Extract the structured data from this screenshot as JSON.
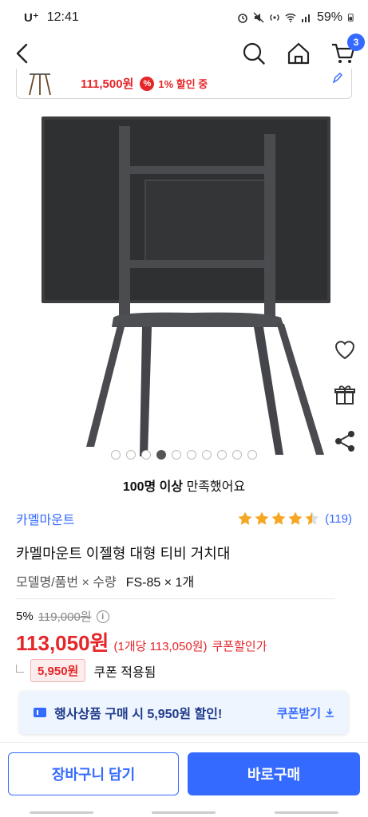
{
  "status": {
    "carrier": "U⁺",
    "time": "12:41",
    "battery": "59%"
  },
  "nav": {
    "cart_count": "3"
  },
  "floating_card": {
    "price": "111,500원",
    "badge": "%",
    "discount_text": "1% 할인 중"
  },
  "carousel": {
    "total_dots": 10,
    "active_index": 3
  },
  "satisfaction": {
    "bold": "100명 이상",
    "rest": " 만족했어요"
  },
  "product": {
    "brand": "카멜마운트",
    "rating": 4.5,
    "review_count": "(119)",
    "title": "카멜마운트 이젤형 대형 티비 거치대",
    "option_label": "모델명/품번 × 수량",
    "option_value": "FS-85 × 1개",
    "discount_rate": "5%",
    "original_price": "119,000원",
    "info_icon": "ⓘ",
    "sale_price": "113,050원",
    "unit_price": "(1개당 113,050원)",
    "coupon_price_label": "쿠폰할인가",
    "coupon_amount": "5,950원",
    "coupon_applied": "쿠폰 적용됨"
  },
  "toast": {
    "text": "행사상품 구매 시 5,950원 할인!",
    "action": "쿠폰받기"
  },
  "bottom": {
    "cart_button": "장바구니 담기",
    "buy_button": "바로구매"
  },
  "colors": {
    "accent": "#346aff",
    "price_red": "#e52528"
  }
}
